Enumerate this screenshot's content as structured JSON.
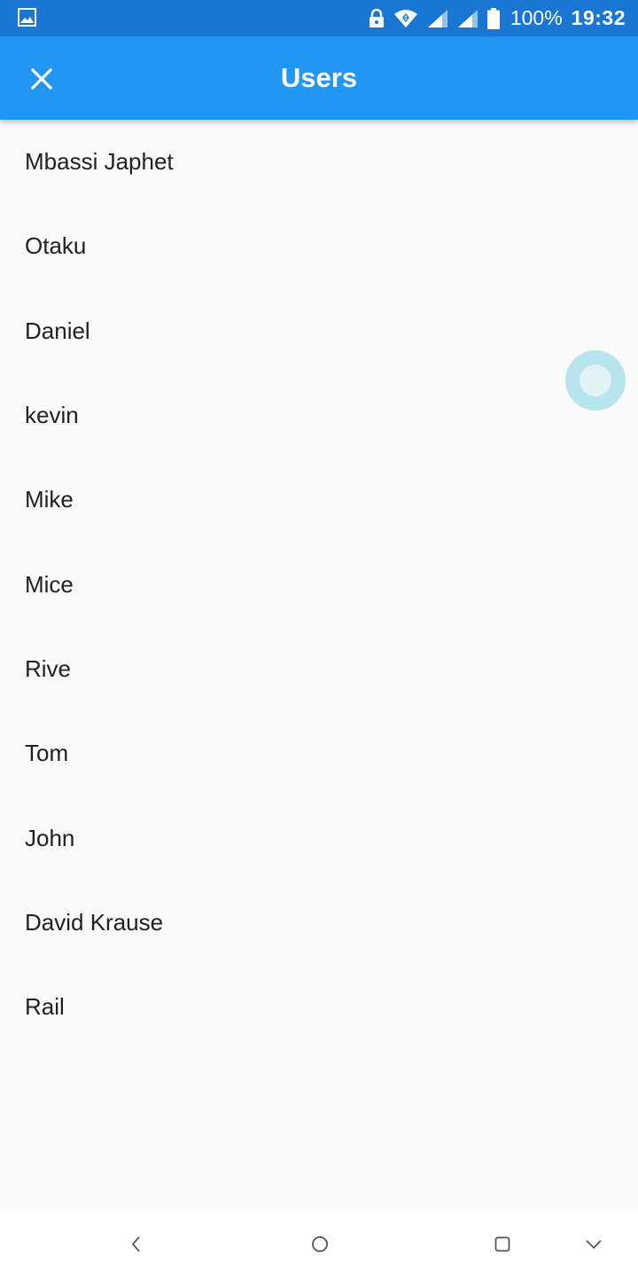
{
  "status_bar": {
    "battery_percent": "100%",
    "time": "19:32",
    "icons": [
      "image-notification-icon",
      "lock-icon",
      "wifi-icon",
      "signal-icon",
      "signal-icon",
      "battery-icon"
    ]
  },
  "app_bar": {
    "title": "Users",
    "close_icon": "close-icon",
    "color": "#2196f3"
  },
  "users": [
    "Mbassi Japhet",
    "Otaku",
    "Daniel",
    "kevin",
    "Mike",
    "Mice",
    "Rive",
    "Tom",
    "John",
    "David Krause",
    "Rail"
  ],
  "nav_bar": {
    "buttons": [
      "back-icon",
      "home-icon",
      "recents-icon",
      "hide-nav-icon"
    ]
  }
}
